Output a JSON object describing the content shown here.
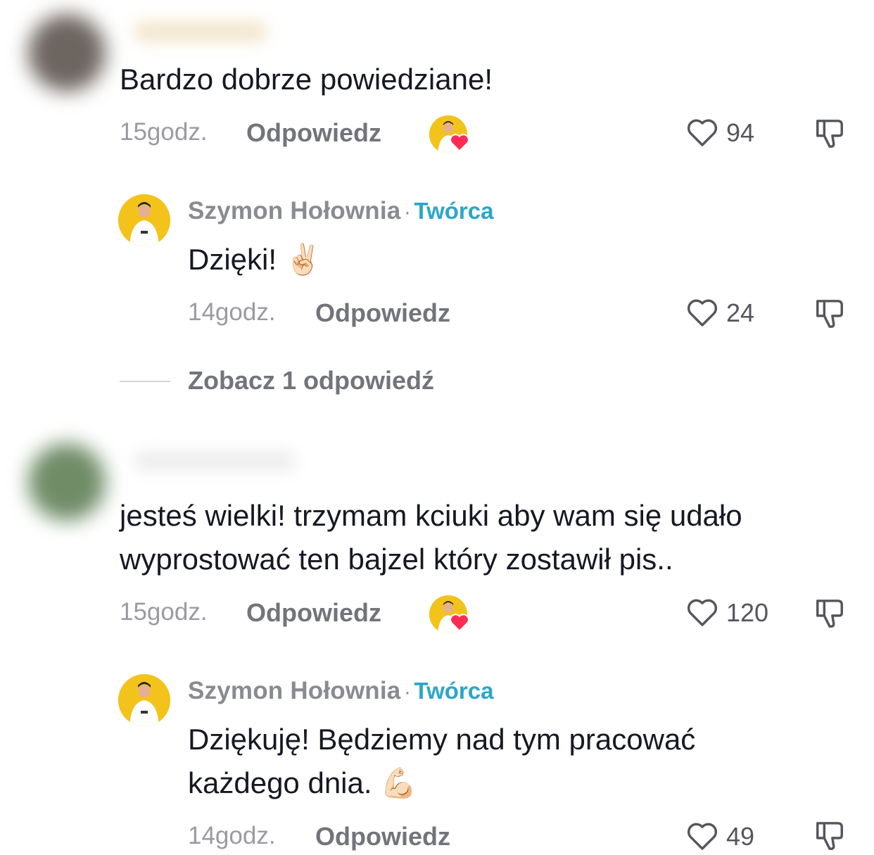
{
  "comments": [
    {
      "text": "Bardzo dobrze powiedziane!",
      "time": "15godz.",
      "reply_label": "Odpowiedz",
      "likes": "94",
      "creator_liked": true,
      "reply": {
        "author": "Szymon Hołownia",
        "separator": "·",
        "badge": "Twórca",
        "text": "Dzięki! ✌🏻",
        "time": "14godz.",
        "reply_label": "Odpowiedz",
        "likes": "24"
      },
      "view_replies": "Zobacz 1 odpowiedź"
    },
    {
      "text_line1": "jesteś wielki! trzymam kciuki aby wam się udało",
      "text_line2": "wyprostować ten bajzel który zostawił pis..",
      "time": "15godz.",
      "reply_label": "Odpowiedz",
      "likes": "120",
      "creator_liked": true,
      "reply": {
        "author": "Szymon Hołownia",
        "separator": "·",
        "badge": "Twórca",
        "text_line1": "Dziękuję! Będziemy nad tym pracować",
        "text_line2": "każdego dnia. 💪🏻",
        "time": "14godz.",
        "reply_label": "Odpowiedz",
        "likes": "49"
      }
    }
  ],
  "icons": {
    "like": "heart-outline-icon",
    "dislike": "thumbs-down-icon",
    "creator_heart": "heart-filled-icon"
  },
  "colors": {
    "creator_badge": "#2ba6c9",
    "heart_red": "#fe2c55",
    "avatar_yellow": "#f3c31b"
  }
}
